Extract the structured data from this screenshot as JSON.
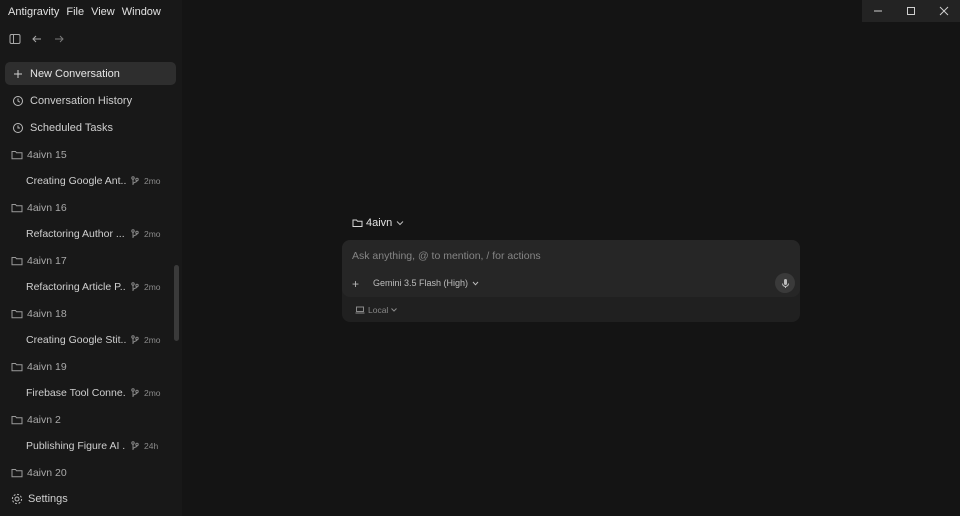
{
  "menu": [
    "Antigravity",
    "File",
    "View",
    "Window"
  ],
  "sidebar": {
    "new_conversation": "New Conversation",
    "conversation_history": "Conversation History",
    "scheduled_tasks": "Scheduled Tasks",
    "settings": "Settings",
    "items": [
      {
        "type": "folder",
        "label": "4aivn 15"
      },
      {
        "type": "conv",
        "title": "Creating Google Ant...",
        "age": "2mo"
      },
      {
        "type": "folder",
        "label": "4aivn 16"
      },
      {
        "type": "conv",
        "title": "Refactoring Author ...",
        "age": "2mo"
      },
      {
        "type": "folder",
        "label": "4aivn 17"
      },
      {
        "type": "conv",
        "title": "Refactoring Article P...",
        "age": "2mo"
      },
      {
        "type": "folder",
        "label": "4aivn 18"
      },
      {
        "type": "conv",
        "title": "Creating Google Stit...",
        "age": "2mo"
      },
      {
        "type": "folder",
        "label": "4aivn 19"
      },
      {
        "type": "conv",
        "title": "Firebase Tool Conne...",
        "age": "2mo"
      },
      {
        "type": "folder",
        "label": "4aivn 2"
      },
      {
        "type": "conv",
        "title": "Publishing Figure AI ...",
        "age": "24h"
      },
      {
        "type": "folder",
        "label": "4aivn 20"
      }
    ]
  },
  "main": {
    "workspace": "4aivn",
    "prompt_placeholder": "Ask anything, @ to mention, / for actions",
    "model": "Gemini 3.5 Flash (High)",
    "environment": "Local"
  },
  "icons": {
    "sidebar_toggle": "sidebar-toggle-icon",
    "back": "arrow-left-icon",
    "forward": "arrow-right-icon",
    "folder": "folder-icon",
    "branch": "branch-icon",
    "mic": "microphone-icon"
  }
}
